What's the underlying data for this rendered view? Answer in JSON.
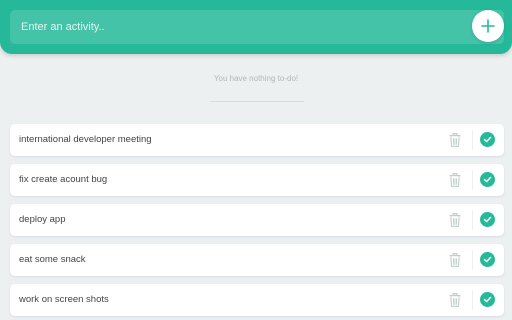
{
  "header": {
    "input_placeholder": "Enter an activity..",
    "add_button_icon": "plus-icon"
  },
  "empty_state": {
    "message": "You have nothing to-do!"
  },
  "todos": [
    {
      "text": "international developer meeting",
      "completed": false
    },
    {
      "text": "fix create acount bug",
      "completed": false
    },
    {
      "text": "deploy app",
      "completed": false
    },
    {
      "text": "eat some snack",
      "completed": false
    },
    {
      "text": "work on screen shots",
      "completed": false
    }
  ],
  "icons": {
    "delete": "trash-icon",
    "complete": "check-icon"
  },
  "colors": {
    "accent": "#25b99a",
    "background": "#edf0f1",
    "card": "#ffffff",
    "text": "#444444",
    "muted": "#b0b8bb"
  }
}
